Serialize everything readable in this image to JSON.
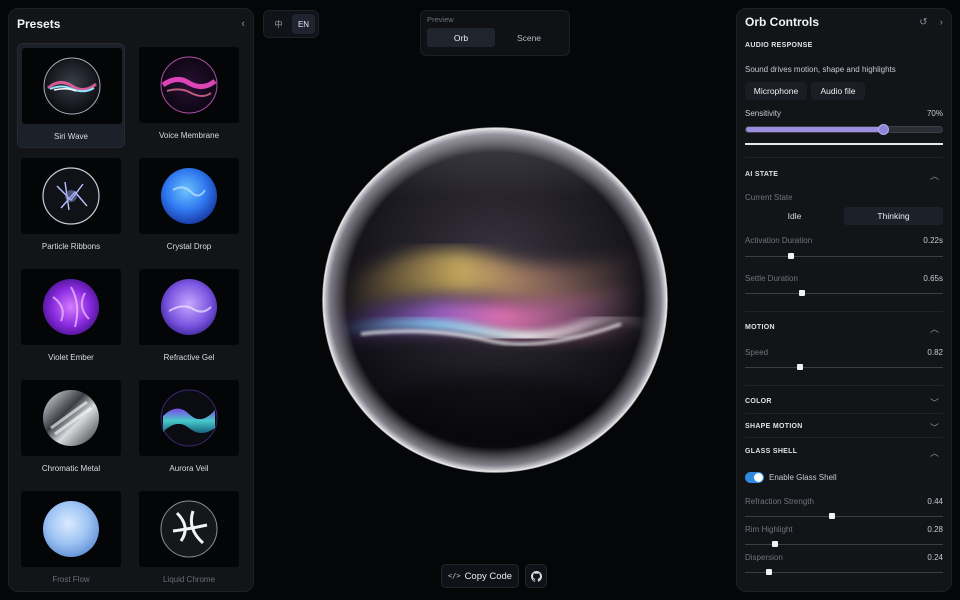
{
  "presets": {
    "title": "Presets",
    "items": [
      {
        "name": "Siri Wave",
        "icon": "siri-wave-orb"
      },
      {
        "name": "Voice Membrane",
        "icon": "voice-membrane-orb"
      },
      {
        "name": "Particle Ribbons",
        "icon": "particle-ribbons-orb"
      },
      {
        "name": "Crystal Drop",
        "icon": "crystal-drop-orb"
      },
      {
        "name": "Violet Ember",
        "icon": "violet-ember-orb"
      },
      {
        "name": "Refractive Gel",
        "icon": "refractive-gel-orb"
      },
      {
        "name": "Chromatic Metal",
        "icon": "chromatic-metal-orb"
      },
      {
        "name": "Aurora Veil",
        "icon": "aurora-veil-orb"
      },
      {
        "name": "Frost Flow",
        "icon": "frost-flow-orb"
      },
      {
        "name": "Liquid Chrome",
        "icon": "liquid-chrome-orb"
      }
    ],
    "selected": "Siri Wave"
  },
  "language": {
    "options": [
      "中",
      "EN"
    ],
    "selected": "EN"
  },
  "preview": {
    "label": "Preview",
    "tabs": [
      "Orb",
      "Scene"
    ],
    "selected": "Orb"
  },
  "actions": {
    "copy_label": "Copy Code"
  },
  "controls": {
    "title": "Orb Controls",
    "audio": {
      "title": "AUDIO RESPONSE",
      "description": "Sound drives motion, shape and highlights",
      "source_microphone": "Microphone",
      "source_file": "Audio file",
      "sensitivity_label": "Sensitivity",
      "sensitivity_value": "70%",
      "sensitivity_fraction": 0.7
    },
    "ai_state": {
      "title": "AI STATE",
      "current_label": "Current State",
      "states": [
        "Idle",
        "Thinking"
      ],
      "selected": "Thinking",
      "activation_label": "Activation Duration",
      "activation_value": "0.22s",
      "activation_fraction": 0.23,
      "settle_label": "Settle Duration",
      "settle_value": "0.65s",
      "settle_fraction": 0.29
    },
    "motion": {
      "title": "MOTION",
      "speed_label": "Speed",
      "speed_value": "0.82",
      "speed_fraction": 0.28
    },
    "color": {
      "title": "COLOR"
    },
    "shape_motion": {
      "title": "SHAPE MOTION"
    },
    "glass": {
      "title": "GLASS SHELL",
      "enable_label": "Enable Glass Shell",
      "enabled": true,
      "refraction_label": "Refraction Strength",
      "refraction_value": "0.44",
      "refraction_fraction": 0.44,
      "rim_label": "Rim Highlight",
      "rim_value": "0.28",
      "rim_fraction": 0.15,
      "dispersion_label": "Dispersion",
      "dispersion_value": "0.24",
      "dispersion_fraction": 0.12
    }
  },
  "colors": {
    "accent": "#9b8ee0",
    "toggle": "#2f8ae0",
    "panel": "#121418",
    "background": "#050608"
  }
}
